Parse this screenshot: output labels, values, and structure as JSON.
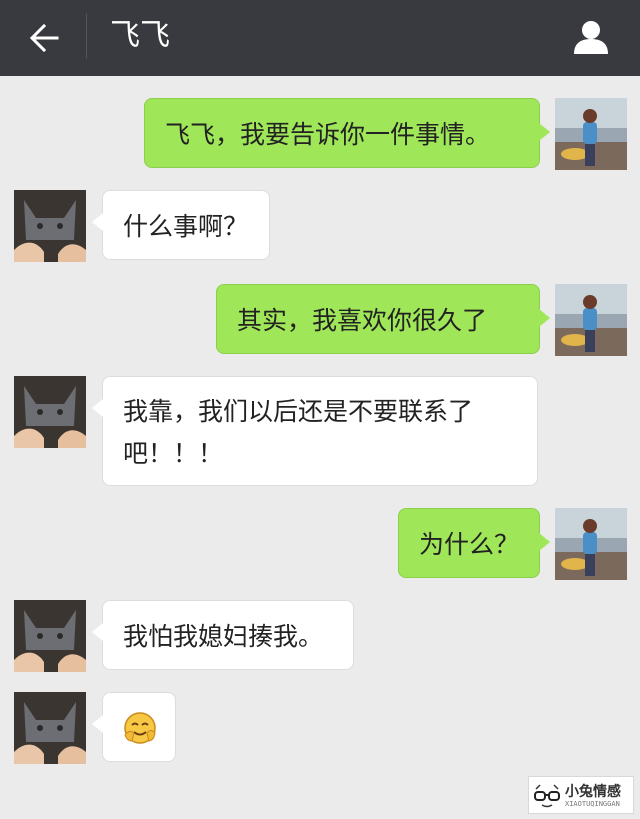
{
  "header": {
    "back_icon": "arrow-left-icon",
    "title": "飞飞",
    "profile_icon": "person-icon"
  },
  "messages": [
    {
      "side": "out",
      "text": "飞飞，我要告诉你一件事情。"
    },
    {
      "side": "in",
      "text": "什么事啊？"
    },
    {
      "side": "out",
      "text": "其实，我喜欢你很久了"
    },
    {
      "side": "in",
      "text": "我靠，我们以后还是不要联系了吧！！！"
    },
    {
      "side": "out",
      "text": "为什么？"
    },
    {
      "side": "in",
      "text": "我怕我媳妇揍我。"
    },
    {
      "side": "in",
      "emoji": "🤗"
    }
  ],
  "watermark": {
    "name": "小兔情感",
    "sub": "XIAOTUQINGGAN"
  },
  "colors": {
    "header_bg": "#393a3f",
    "chat_bg": "#ebebeb",
    "outgoing_bubble": "#9fe658",
    "incoming_bubble": "#ffffff"
  }
}
